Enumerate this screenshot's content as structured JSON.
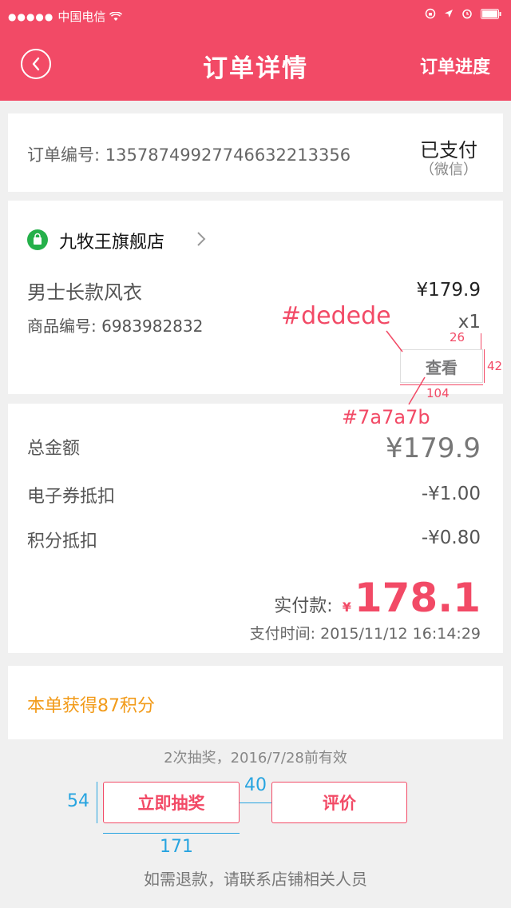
{
  "status_bar": {
    "carrier": "中国电信",
    "signal": "●●●●●"
  },
  "header": {
    "title": "订单详情",
    "right_link": "订单进度"
  },
  "order": {
    "number_label": "订单编号",
    "number": "13578749927746632213356",
    "status": "已支付",
    "pay_method": "（微信）"
  },
  "shop": {
    "name": "九牧王旗舰店"
  },
  "goods": {
    "name": "男士长款风衣",
    "price": "¥179.9",
    "code_label": "商品编号",
    "code": "6983982832",
    "qty": "x1",
    "view_button": "查看"
  },
  "amounts": {
    "total_label": "总金额",
    "total": "¥179.9",
    "coupon_label": "电子券抵扣",
    "coupon": "-¥1.00",
    "points_label": "积分抵扣",
    "points": "-¥0.80",
    "paid_label": "实付款:",
    "paid_currency": "¥",
    "paid": "178.1",
    "pay_time_label": "支付时间",
    "pay_time": "2015/11/12   16:14:29"
  },
  "points_earned": "本单获得87积分",
  "lottery_note": "2次抽奖，2016/7/28前有效",
  "buttons": {
    "draw": "立即抽奖",
    "review": "评价"
  },
  "refund_note": "如需退款，请联系店铺相关人员",
  "annotations": {
    "border_color": "#dedede",
    "text_color": "#7a7a7b",
    "btn_gap_26": "26",
    "btn_height": "42",
    "btn_width": "104",
    "lottery_height": "54",
    "lottery_gap": "40",
    "lottery_width": "171"
  },
  "colors": {
    "brand": "#f24a66",
    "points": "#f29b1a",
    "annotation_blue": "#27a4e0"
  }
}
